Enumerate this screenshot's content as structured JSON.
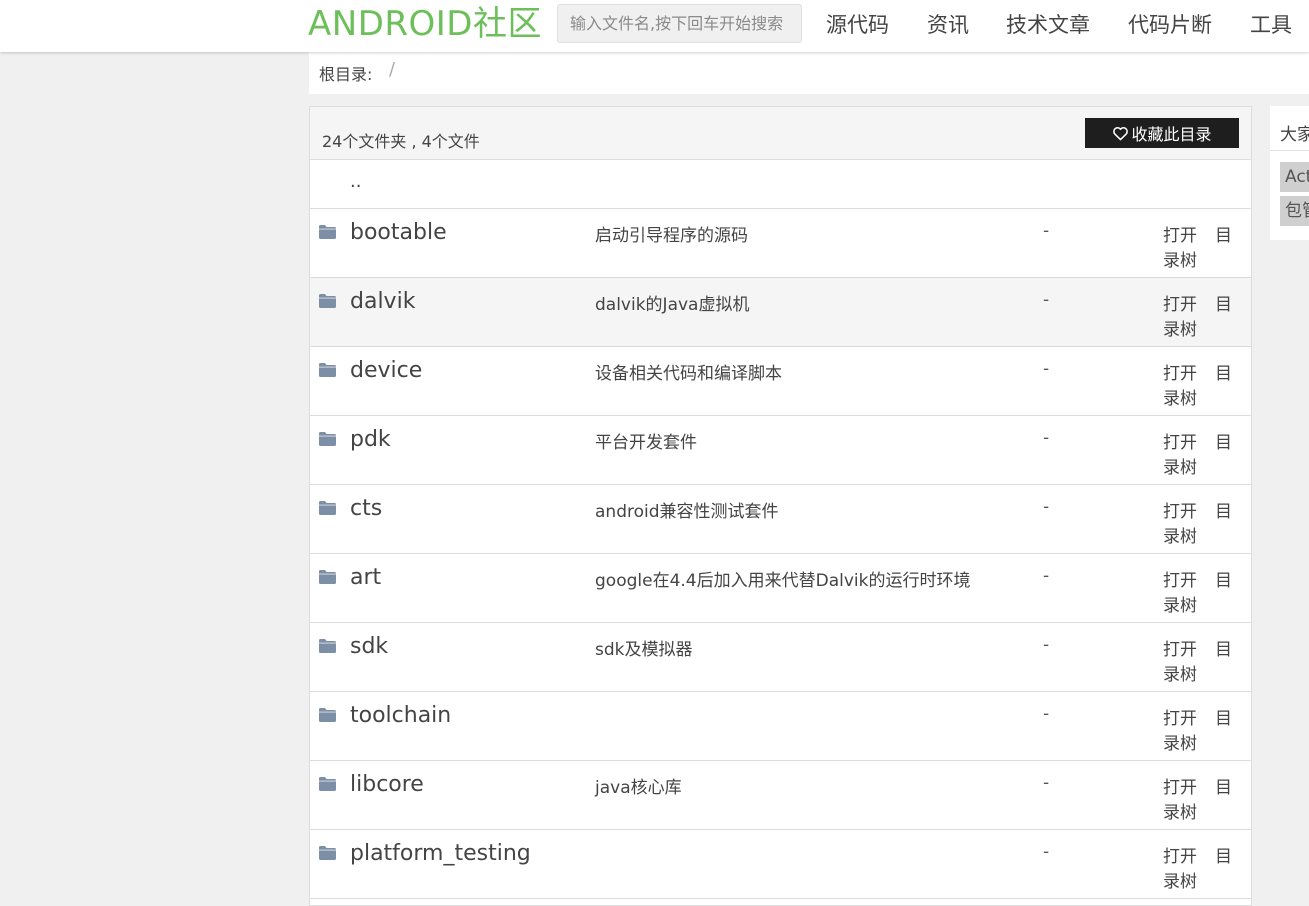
{
  "header": {
    "logo": "ANDROID社区",
    "search_placeholder": "输入文件名,按下回车开始搜索",
    "nav": [
      "源代码",
      "资讯",
      "技术文章",
      "代码片断",
      "工具"
    ]
  },
  "breadcrumb": {
    "label": "根目录:",
    "separator": "/"
  },
  "panel": {
    "summary": "24个文件夹 , 4个文件",
    "favorite_button": "收藏此目录",
    "parent_link": ".."
  },
  "actions": {
    "open": "打开",
    "tree_first": "目",
    "tree_rest": "录树"
  },
  "rows": [
    {
      "name": "bootable",
      "desc": "启动引导程序的源码",
      "size": "-"
    },
    {
      "name": "dalvik",
      "desc": "dalvik的Java虚拟机",
      "size": "-"
    },
    {
      "name": "device",
      "desc": "设备相关代码和编译脚本",
      "size": "-"
    },
    {
      "name": "pdk",
      "desc": "平台开发套件",
      "size": "-"
    },
    {
      "name": "cts",
      "desc": "android兼容性测试套件",
      "size": "-"
    },
    {
      "name": "art",
      "desc": "google在4.4后加入用来代替Dalvik的运行时环境",
      "size": "-"
    },
    {
      "name": "sdk",
      "desc": "sdk及模拟器",
      "size": "-"
    },
    {
      "name": "toolchain",
      "desc": "",
      "size": "-"
    },
    {
      "name": "libcore",
      "desc": "java核心库",
      "size": "-"
    },
    {
      "name": "platform_testing",
      "desc": "",
      "size": "-"
    }
  ],
  "sidebar": {
    "title": "大家",
    "tags": [
      "Act",
      "包管"
    ]
  },
  "colors": {
    "logo": "#6dbf5a",
    "folder_icon": "#7d8fa6",
    "button_bg": "#1e1e1e"
  }
}
